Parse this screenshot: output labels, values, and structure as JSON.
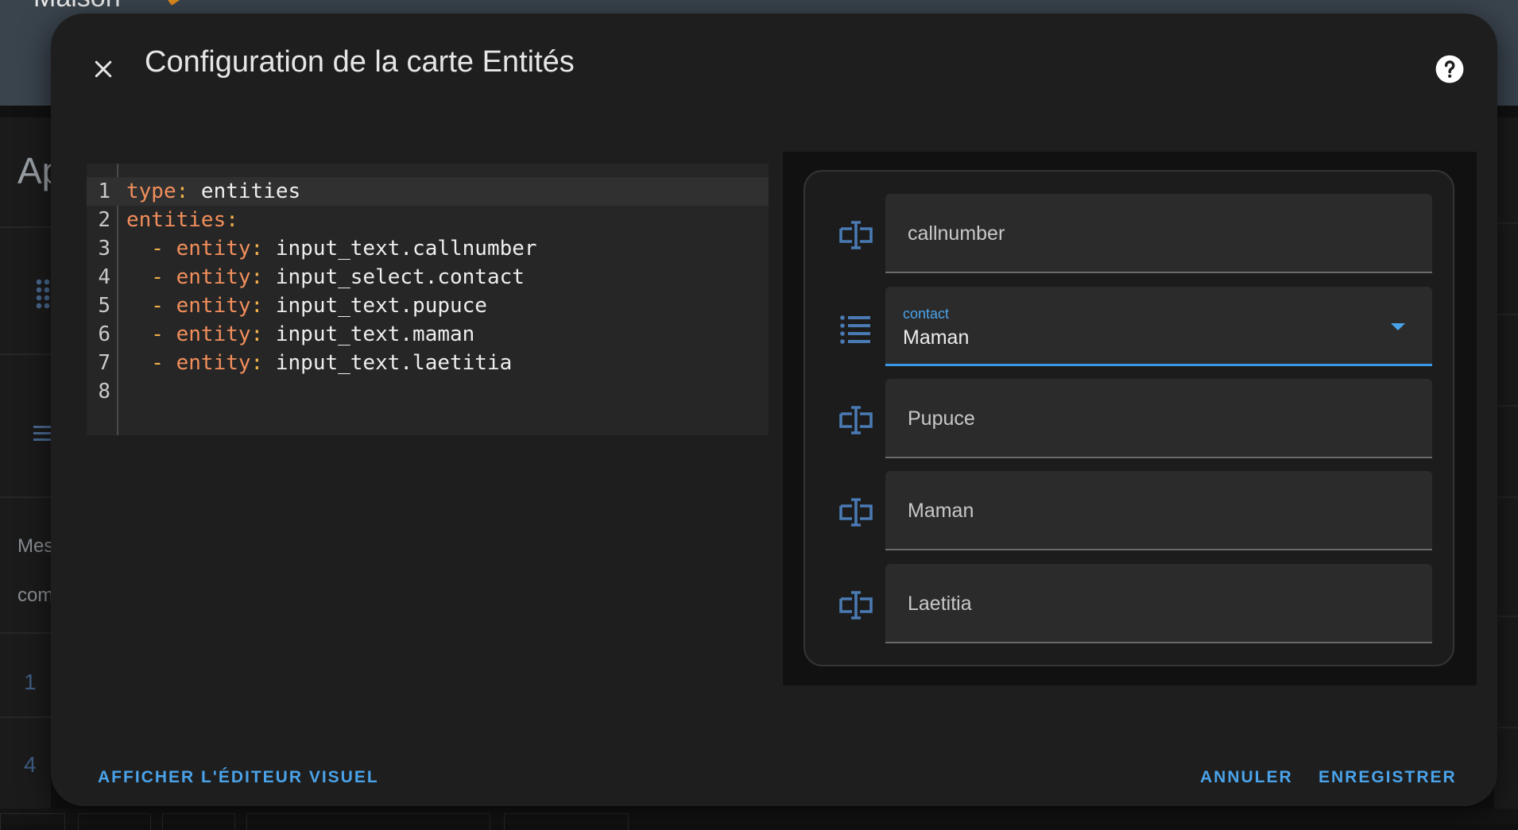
{
  "background": {
    "app_title": "Maison",
    "heading": "Ap",
    "text_1": "Mes",
    "text_2": "com",
    "number_1": "1",
    "number_2": "4"
  },
  "dialog": {
    "title": "Configuration de la carte Entités",
    "close_icon": "close-icon",
    "help_icon": "help-circle-icon"
  },
  "yaml_editor": {
    "lines": [
      {
        "n": "1",
        "key": "type",
        "value": " entities"
      },
      {
        "n": "2",
        "key": "entities",
        "value": ""
      },
      {
        "n": "3",
        "dash": "  - ",
        "key": "entity",
        "value": " input_text.callnumber"
      },
      {
        "n": "4",
        "dash": "  - ",
        "key": "entity",
        "value": " input_select.contact"
      },
      {
        "n": "5",
        "dash": "  - ",
        "key": "entity",
        "value": " input_text.pupuce"
      },
      {
        "n": "6",
        "dash": "  - ",
        "key": "entity",
        "value": " input_text.maman"
      },
      {
        "n": "7",
        "dash": "  - ",
        "key": "entity",
        "value": " input_text.laetitia"
      },
      {
        "n": "8",
        "key": "",
        "value": ""
      }
    ]
  },
  "preview": {
    "rows": [
      {
        "icon": "form-textbox-icon",
        "type": "text",
        "value": "callnumber"
      },
      {
        "icon": "format-list-bulleted-icon",
        "type": "select",
        "label": "contact",
        "value": "Maman"
      },
      {
        "icon": "form-textbox-icon",
        "type": "text",
        "value": "Pupuce"
      },
      {
        "icon": "form-textbox-icon",
        "type": "text",
        "value": "Maman"
      },
      {
        "icon": "form-textbox-icon",
        "type": "text",
        "value": "Laetitia"
      }
    ]
  },
  "footer": {
    "show_visual_editor": "AFFICHER L'ÉDITEUR VISUEL",
    "cancel": "ANNULER",
    "save": "ENREGISTRER"
  },
  "colors": {
    "accent": "#4aa3ea",
    "yaml_key": "#f28f5c",
    "yaml_punct": "#f3b14a",
    "icon": "#4a7ab3"
  }
}
